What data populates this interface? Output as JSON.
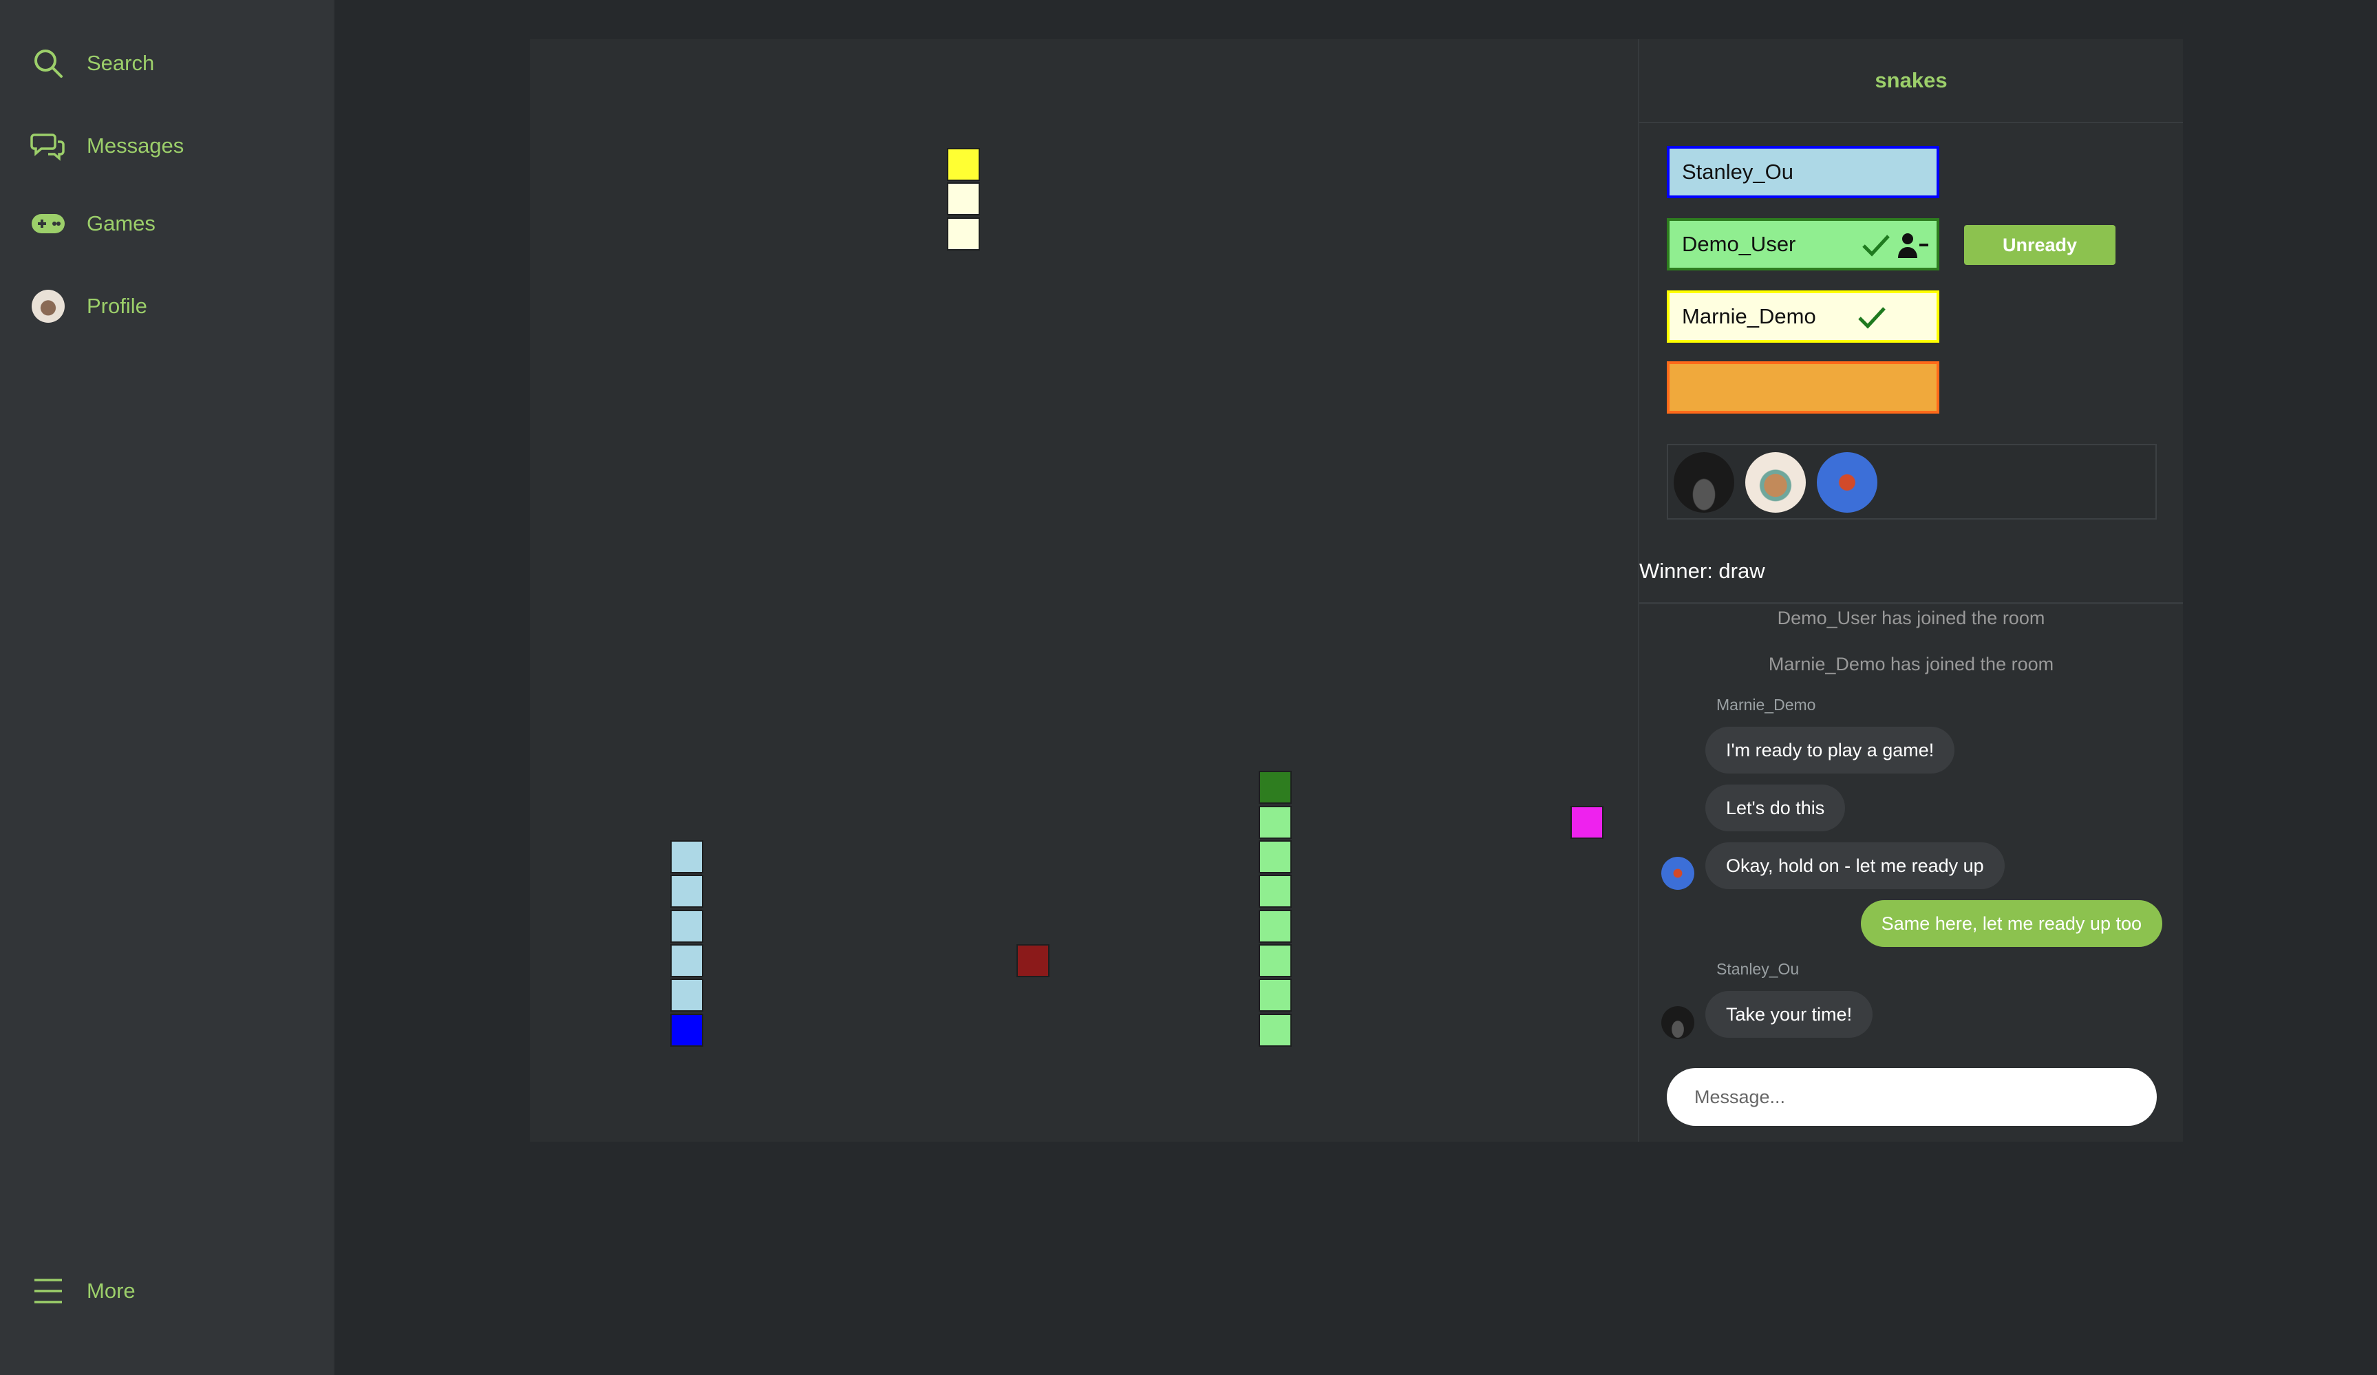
{
  "sidebar": {
    "items": [
      {
        "label": "Search",
        "icon": "search-icon"
      },
      {
        "label": "Messages",
        "icon": "chat-bubbles-icon"
      },
      {
        "label": "Games",
        "icon": "gamepad-icon"
      },
      {
        "label": "Profile",
        "icon": "profile-avatar"
      }
    ],
    "more_label": "More",
    "accent_color": "#9ccf6a"
  },
  "room": {
    "title": "snakes",
    "players": [
      {
        "name": "Stanley_Ou",
        "color": "#add8e6",
        "border": "#0000ff",
        "ready": false
      },
      {
        "name": "Demo_User",
        "color": "#90ee90",
        "border": "#2e7d1f",
        "ready": true,
        "leave_icon": "remove-user-icon"
      },
      {
        "name": "Marnie_Demo",
        "color": "#ffffe0",
        "border": "#ffff00",
        "ready": true
      },
      {
        "name": "",
        "color": "#f0a93c",
        "border": "#ff6a1a",
        "ready": false
      }
    ],
    "unready_label": "Unready",
    "spectators": [
      "car-avatar",
      "owl-avatar",
      "headphones-avatar"
    ],
    "winner_text": "Winner: draw"
  },
  "chat": {
    "system_messages": [
      "Demo_User has joined the room",
      "Marnie_Demo has joined the room"
    ],
    "marnie_sender": "Marnie_Demo",
    "messages": [
      "I'm ready to play a game!",
      "Let's do this",
      "Okay, hold on - let me ready up",
      "Same here, let me ready up too",
      "Take your time!"
    ],
    "stanley_sender": "Stanley_Ou",
    "input_placeholder": "Message..."
  },
  "game": {
    "snakes": [
      {
        "player": "Marnie_Demo",
        "head_color": "#ffff33",
        "body_color": "#ffffe0",
        "cells": [
          [
            12,
            2
          ],
          [
            12,
            3
          ],
          [
            12,
            4
          ]
        ]
      },
      {
        "player": "Stanley_Ou",
        "head_color": "#0000ff",
        "body_color": "#add8e6",
        "cells": [
          [
            4,
            27
          ],
          [
            4,
            26
          ],
          [
            4,
            25
          ],
          [
            4,
            24
          ],
          [
            4,
            23
          ],
          [
            4,
            22
          ]
        ]
      },
      {
        "player": "Demo_User",
        "head_color": "#2e7d1f",
        "body_color": "#90ee90",
        "cells": [
          [
            21,
            20
          ],
          [
            21,
            21
          ],
          [
            21,
            22
          ],
          [
            21,
            23
          ],
          [
            21,
            24
          ],
          [
            21,
            25
          ],
          [
            21,
            26
          ],
          [
            21,
            27
          ]
        ]
      }
    ],
    "food": [
      {
        "color": "#8b1a1a",
        "cell": [
          14,
          25
        ]
      },
      {
        "color": "#ee22ee",
        "cell": [
          30,
          21
        ]
      }
    ]
  }
}
